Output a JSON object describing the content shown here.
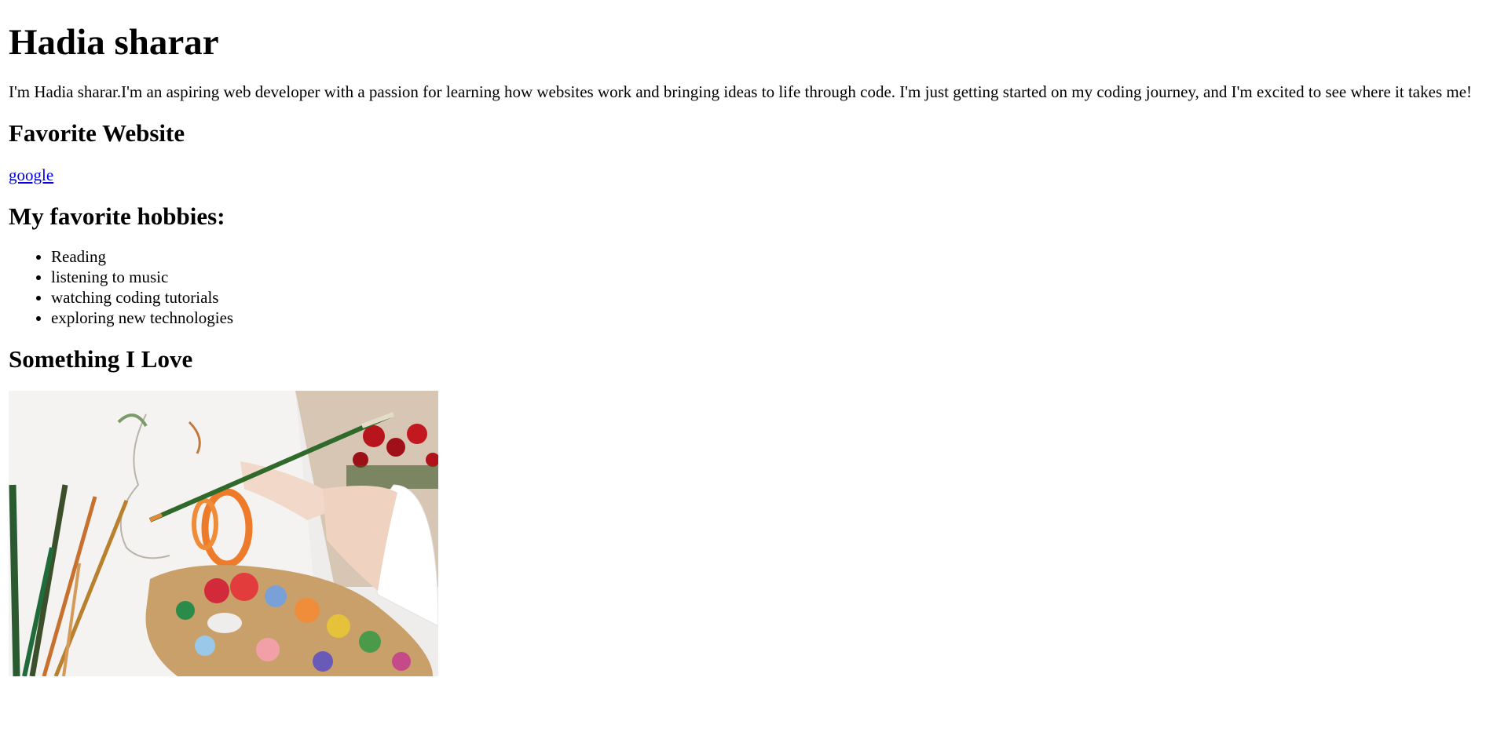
{
  "header": {
    "title": "Hadia sharar"
  },
  "intro": {
    "text": "I'm Hadia sharar.I'm an aspiring web developer with a passion for learning how websites work and bringing ideas to life through code. I'm just getting started on my coding journey, and I'm excited to see where it takes me!"
  },
  "favorite_website": {
    "heading": "Favorite Website",
    "link_text": "google"
  },
  "hobbies": {
    "heading": "My favorite hobbies:",
    "items": [
      "Reading",
      "listening to music",
      "watching coding tutorials",
      "exploring new technologies"
    ]
  },
  "love": {
    "heading": "Something I Love",
    "image": "painting-photo"
  }
}
